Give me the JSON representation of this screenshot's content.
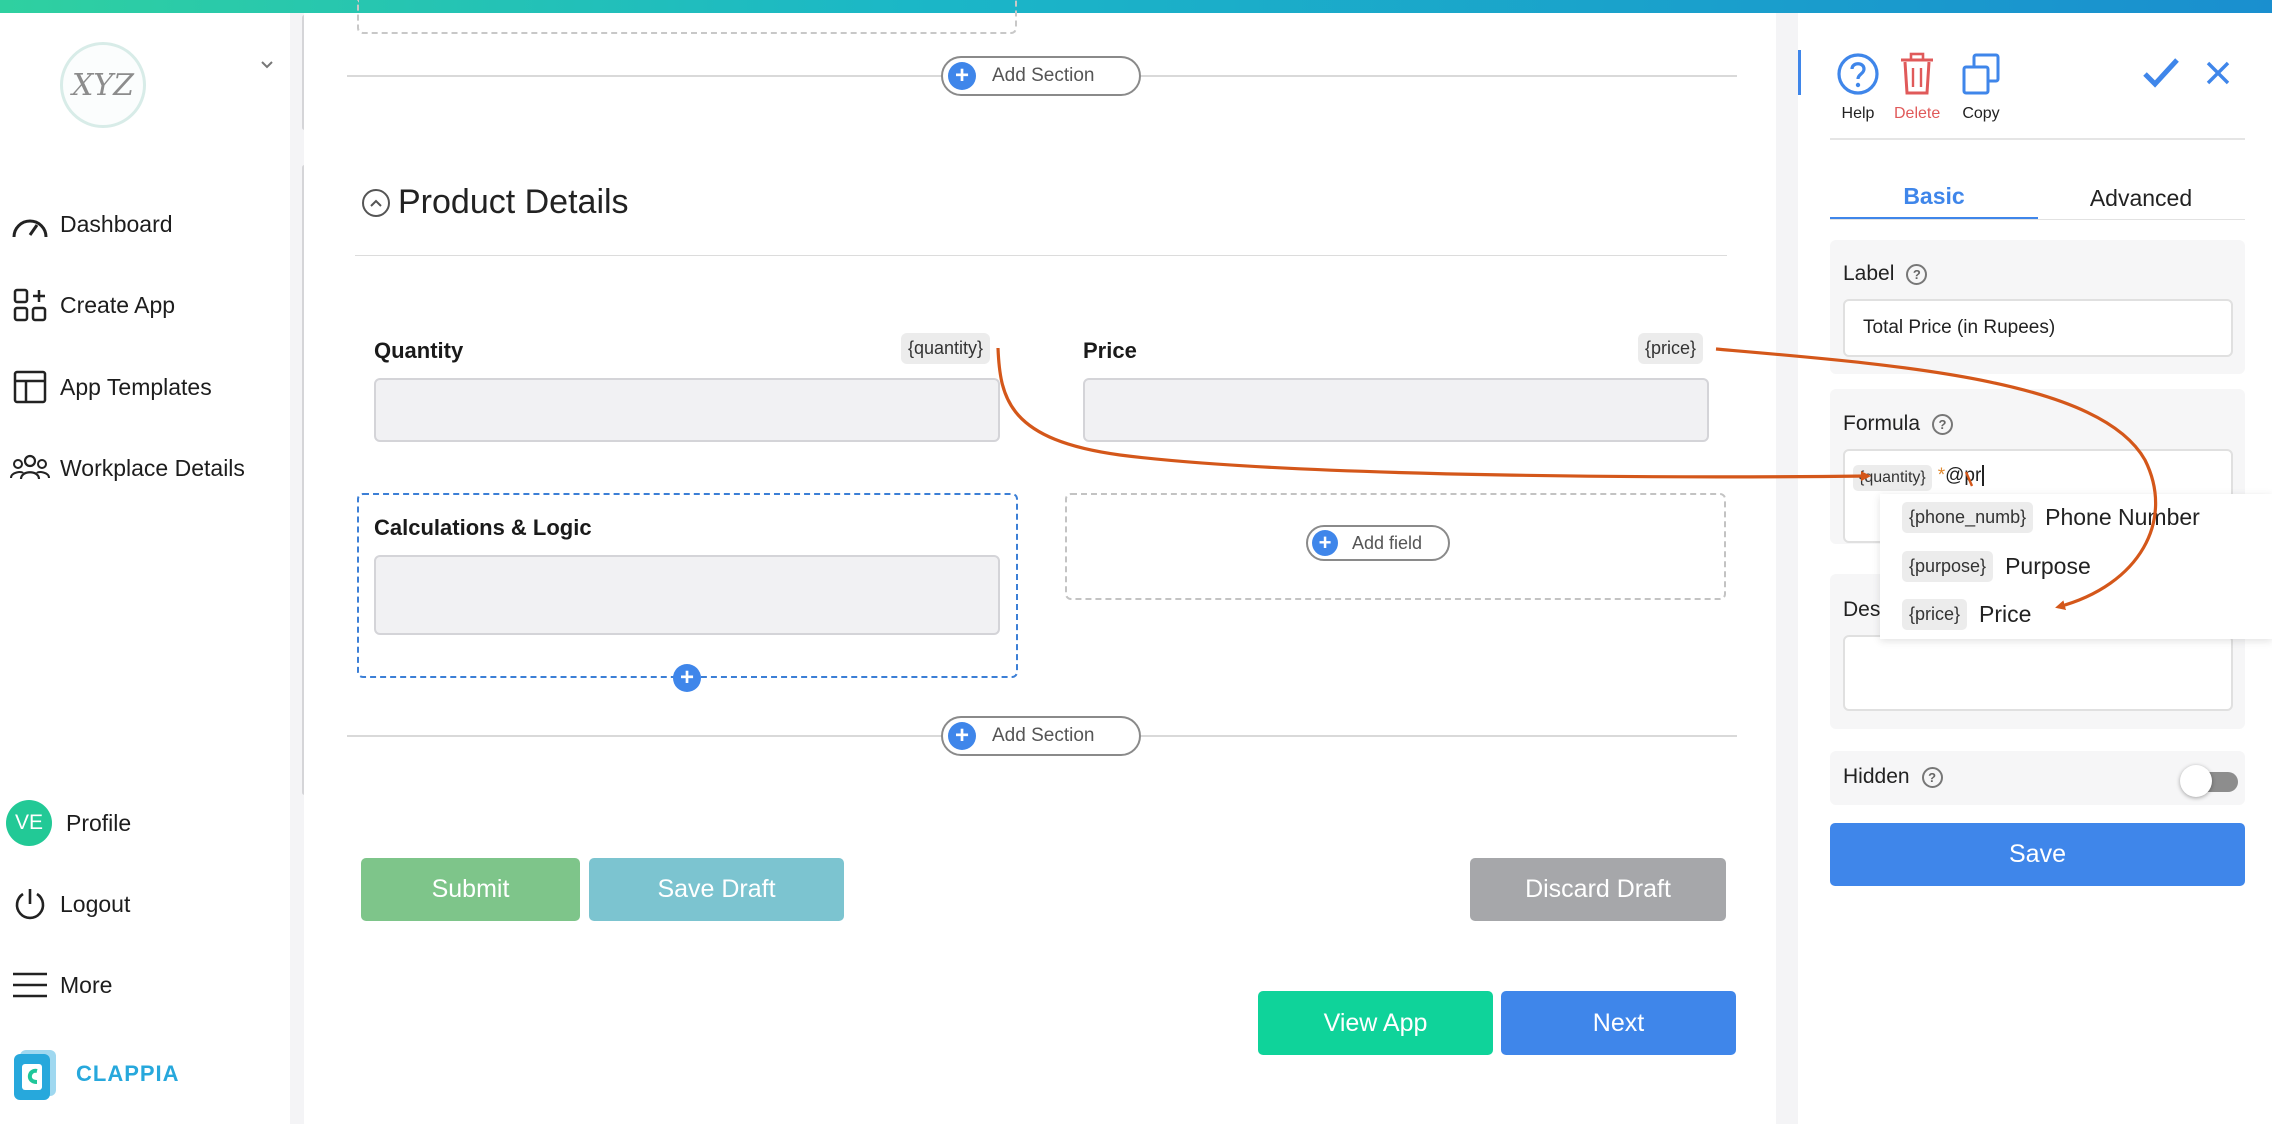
{
  "sidebar": {
    "logo_text": "XYZ",
    "items": [
      {
        "label": "Dashboard",
        "icon": "speedometer-icon"
      },
      {
        "label": "Create App",
        "icon": "grid-plus-icon"
      },
      {
        "label": "App Templates",
        "icon": "template-icon"
      },
      {
        "label": "Workplace Details",
        "icon": "users-icon"
      }
    ],
    "profile": {
      "initials": "VE",
      "label": "Profile"
    },
    "logout_label": "Logout",
    "more_label": "More",
    "brand": "CLAPPIA"
  },
  "builder": {
    "add_section_label": "Add Section",
    "section_title": "Product Details",
    "fields": {
      "quantity": {
        "label": "Quantity",
        "tag": "{quantity}"
      },
      "price": {
        "label": "Price",
        "tag": "{price}"
      },
      "calc": {
        "label": "Calculations & Logic"
      }
    },
    "add_field_label": "Add field",
    "buttons": {
      "submit": "Submit",
      "save_draft": "Save Draft",
      "discard_draft": "Discard Draft",
      "view_app": "View App",
      "next": "Next"
    }
  },
  "panel": {
    "tools": {
      "help": "Help",
      "delete": "Delete",
      "copy": "Copy"
    },
    "tabs": {
      "basic": "Basic",
      "advanced": "Advanced"
    },
    "label": {
      "title": "Label",
      "value": "Total Price (in Rupees)"
    },
    "formula": {
      "title": "Formula",
      "tag": "{quantity}",
      "operator": "*",
      "typed": "@pr"
    },
    "description_title_partial": "Des",
    "suggestions": [
      {
        "tag": "{phone_numb}",
        "label": "Phone Number"
      },
      {
        "tag": "{purpose}",
        "label": "Purpose"
      },
      {
        "tag": "{price}",
        "label": "Price"
      }
    ],
    "hidden": {
      "title": "Hidden",
      "on": false
    },
    "save_label": "Save"
  },
  "colors": {
    "accent": "#3f86ea",
    "submit": "#7ec58a",
    "save_draft": "#7cc4d0",
    "discard_draft": "#a6a7aa",
    "view_app": "#0fd39a",
    "annotation_arrow": "#d4571a",
    "delete": "#e05a5a"
  }
}
